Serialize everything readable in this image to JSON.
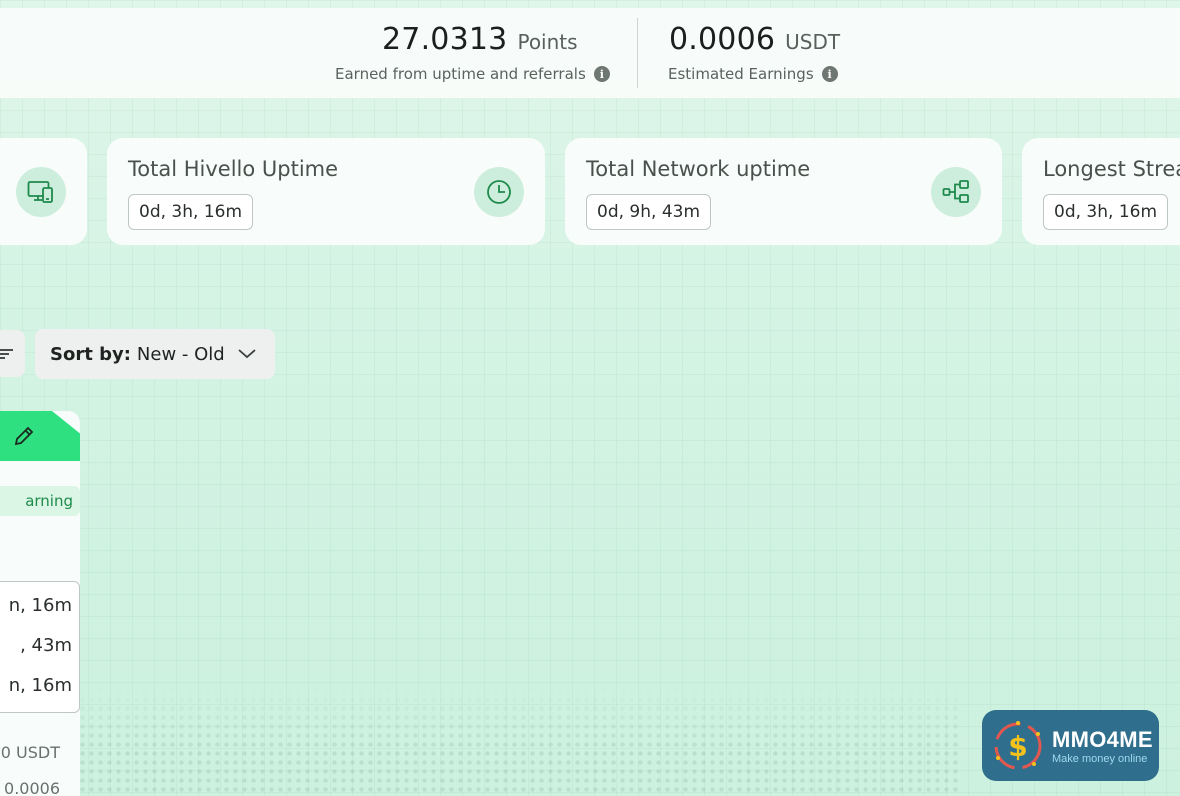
{
  "stats": {
    "points": {
      "value": "27.0313",
      "unit": "Points",
      "caption": "Earned from uptime and referrals"
    },
    "earnings": {
      "value": "0.0006",
      "unit": "USDT",
      "caption": "Estimated Earnings"
    },
    "info_icon": "info-icon"
  },
  "cards": [
    {
      "title": "Total Hivello Uptime",
      "value": "0d, 3h, 16m",
      "icon": "clock-icon"
    },
    {
      "title": "Total Network uptime",
      "value": "0d, 9h, 43m",
      "icon": "network-icon"
    },
    {
      "title": "Longest Strea",
      "value": "0d, 3h, 16m",
      "icon": ""
    }
  ],
  "partial_card_icon": "devices-icon",
  "sort": {
    "label": "Sort by:",
    "value": "New - Old"
  },
  "node": {
    "status": "arning",
    "uptimes": [
      "n, 16m",
      ", 43m",
      "n, 16m"
    ],
    "earnings_usdt": "0 USDT",
    "earnings_value": "0.0006"
  },
  "watermark": {
    "brand": "MMO4ME",
    "tagline": "Make money online"
  },
  "colors": {
    "accent": "#2fe080",
    "icon_green": "#1e8a4c",
    "icon_bg": "#cdeedc"
  }
}
